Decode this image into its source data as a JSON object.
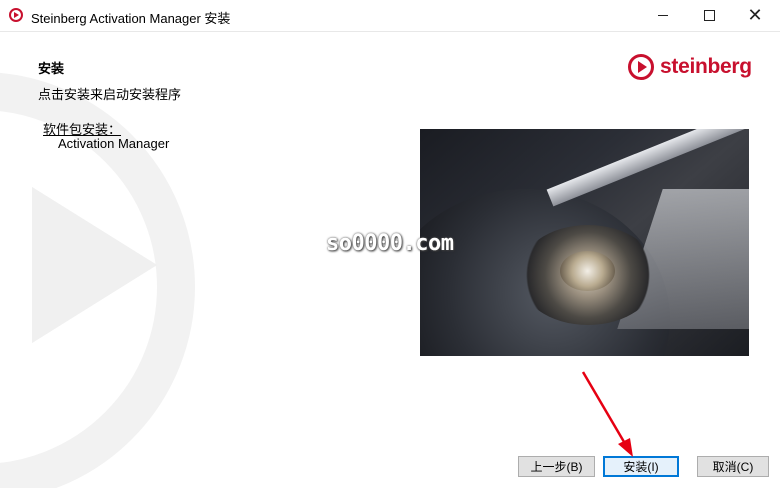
{
  "window": {
    "title": "Steinberg Activation Manager 安装",
    "controls": {
      "minimize": "minimize-icon",
      "maximize": "maximize-icon",
      "close": "close-icon"
    }
  },
  "page": {
    "heading": "安装",
    "subheading": "点击安装来启动安装程序",
    "package_label": "软件包安装：",
    "package_items": [
      "Activation Manager"
    ]
  },
  "brand": {
    "name": "steinberg",
    "color": "#c8102e"
  },
  "overlay": {
    "watermark": "so0000.com"
  },
  "buttons": {
    "back": "上一步(B)",
    "install": "安装(I)",
    "cancel": "取消(C)"
  },
  "colors": {
    "accent": "#0078d7",
    "arrow": "#e60012"
  }
}
